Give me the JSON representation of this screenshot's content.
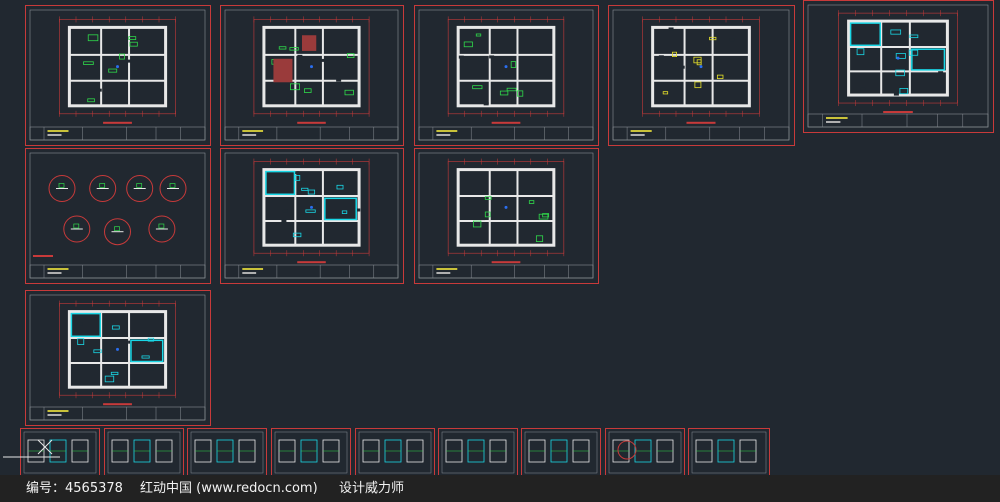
{
  "footer": {
    "id_text": "编号：4565378",
    "site_text": "红动中国 (www.redocn.com)",
    "tag_text": "设计威力师"
  },
  "colors": {
    "background": "#212830",
    "frame": "#c83a3a",
    "wall": "#e8e8e8",
    "cyan": "#19d7e6",
    "green": "#2fd94a",
    "yellow": "#e6e02a",
    "title_yellow": "#c9c23a"
  },
  "sheets": [
    {
      "name": "sheet-floor-plan-1",
      "kind": "plan"
    },
    {
      "name": "sheet-floor-plan-2",
      "kind": "plan-alt"
    },
    {
      "name": "sheet-floor-plan-3",
      "kind": "plan"
    },
    {
      "name": "sheet-floor-plan-4",
      "kind": "plan-yellow"
    },
    {
      "name": "sheet-floor-plan-5",
      "kind": "plan-cyan"
    },
    {
      "name": "sheet-detail-circles",
      "kind": "circles"
    },
    {
      "name": "sheet-floor-plan-6",
      "kind": "plan-cyan"
    },
    {
      "name": "sheet-floor-plan-7",
      "kind": "plan"
    },
    {
      "name": "sheet-floor-plan-8",
      "kind": "plan-cyan"
    }
  ],
  "elevations": [
    "elevation-sheet-1",
    "elevation-sheet-2",
    "elevation-sheet-3",
    "elevation-sheet-4",
    "elevation-sheet-5",
    "elevation-sheet-6",
    "elevation-sheet-7",
    "elevation-sheet-8",
    "elevation-sheet-9"
  ]
}
